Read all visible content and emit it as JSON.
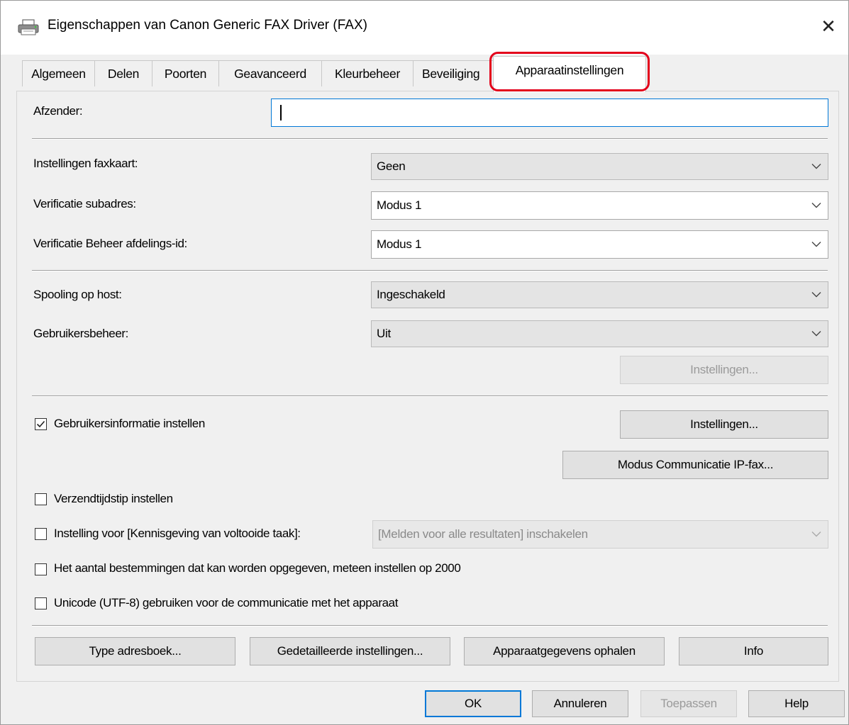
{
  "window": {
    "title": "Eigenschappen van Canon Generic FAX Driver (FAX)",
    "close_glyph": "✕",
    "icon": "printer-icon"
  },
  "tabs": [
    {
      "label": "Algemeen"
    },
    {
      "label": "Delen"
    },
    {
      "label": "Poorten"
    },
    {
      "label": "Geavanceerd"
    },
    {
      "label": "Kleurbeheer"
    },
    {
      "label": "Beveiliging"
    },
    {
      "label": "Apparaatinstellingen",
      "active": true
    }
  ],
  "colors": {
    "highlight": "#e3001b",
    "focus": "#0078d7"
  },
  "sender": {
    "label": "Afzender:",
    "value": ""
  },
  "fields": {
    "fax_card": {
      "label": "Instellingen faxkaart:",
      "value": "Geen"
    },
    "sub_address": {
      "label": "Verificatie subadres:",
      "value": "Modus 1"
    },
    "dept_id": {
      "label": "Verificatie Beheer afdelings-id:",
      "value": "Modus 1"
    },
    "spooling": {
      "label": "Spooling op host:",
      "value": "Ingeschakeld"
    },
    "user_mgmt": {
      "label": "Gebruikersbeheer:",
      "value": "Uit"
    }
  },
  "buttons": {
    "user_mgmt_settings": "Instellingen...",
    "user_info_settings": "Instellingen...",
    "ip_fax_mode": "Modus Communicatie IP-fax...",
    "address_book_type": "Type adresboek...",
    "detailed_settings": "Gedetailleerde instellingen...",
    "get_device_info": "Apparaatgegevens ophalen",
    "info": "Info",
    "ok": "OK",
    "cancel": "Annuleren",
    "apply": "Toepassen",
    "help": "Help"
  },
  "checkboxes": {
    "user_info": {
      "label": "Gebruikersinformatie instellen",
      "checked": true
    },
    "send_time": {
      "label": "Verzendtijdstip instellen",
      "checked": false
    },
    "job_notify": {
      "label": "Instelling voor [Kennisgeving van voltooide taak]:",
      "checked": false
    },
    "destinations": {
      "label": "Het aantal bestemmingen dat kan worden opgegeven, meteen instellen op 2000",
      "checked": false
    },
    "unicode": {
      "label": "Unicode (UTF-8) gebruiken voor de communicatie met het apparaat",
      "checked": false
    }
  },
  "job_notify_combo": {
    "value": "[Melden voor alle resultaten] inschakelen"
  }
}
